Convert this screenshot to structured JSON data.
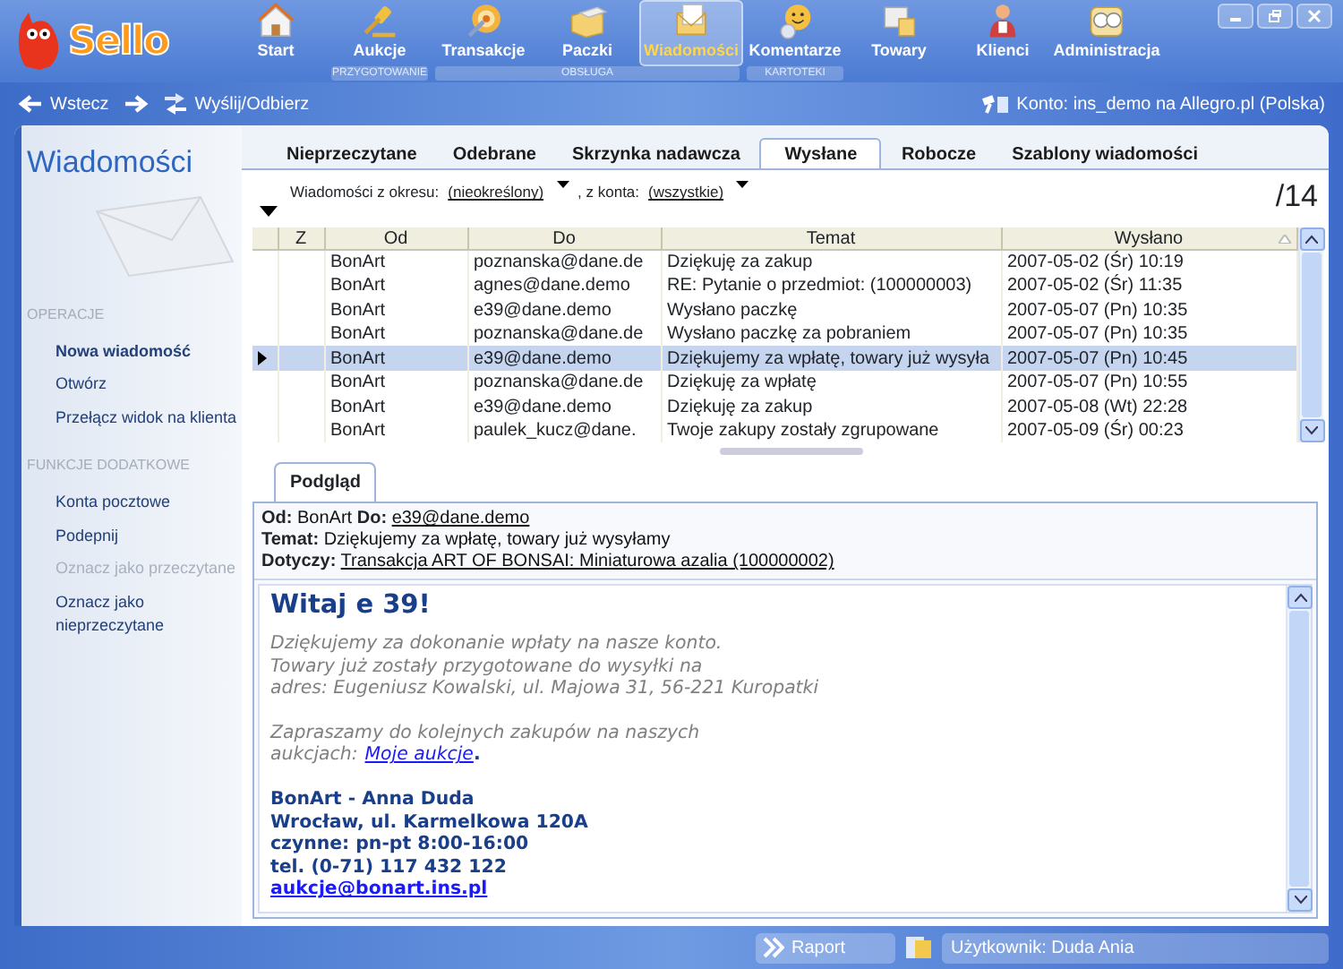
{
  "logo": {
    "text": "Sello"
  },
  "toolbar": [
    {
      "items": [
        {
          "label": "Start",
          "selected": false
        }
      ]
    },
    {
      "group": "PRZYGOTOWANIE",
      "items": [
        {
          "label": "Aukcje",
          "selected": false
        }
      ]
    },
    {
      "group": "OBSŁUGA",
      "items": [
        {
          "label": "Transakcje",
          "selected": false
        },
        {
          "label": "Paczki",
          "selected": false
        },
        {
          "label": "Wiadomości",
          "selected": true
        }
      ]
    },
    {
      "group": "KARTOTEKI",
      "items": [
        {
          "label": "Komentarze",
          "selected": false
        }
      ]
    },
    {
      "items": [
        {
          "label": "Towary",
          "selected": false
        },
        {
          "label": "Klienci",
          "selected": false
        },
        {
          "label": "Administracja",
          "selected": false
        }
      ]
    }
  ],
  "nav": {
    "back": "Wstecz",
    "send_receive": "Wyślij/Odbierz",
    "account": "Konto: ins_demo na Allegro.pl (Polska)"
  },
  "sidebar": {
    "title": "Wiadomości",
    "sections": [
      {
        "heading": "OPERACJE",
        "items": [
          {
            "label": "Nowa wiadomość",
            "default": true,
            "disabled": false
          },
          {
            "label": "Otwórz",
            "default": false,
            "disabled": false
          },
          {
            "label": "Przełącz widok na klienta",
            "default": false,
            "disabled": false
          }
        ]
      },
      {
        "heading": "FUNKCJE DODATKOWE",
        "items": [
          {
            "label": "Konta pocztowe",
            "default": false,
            "disabled": false
          },
          {
            "label": "Podepnij",
            "default": false,
            "disabled": false
          },
          {
            "label": "Oznacz jako przeczytane",
            "default": false,
            "disabled": true
          },
          {
            "label": "Oznacz jako nieprzeczytane",
            "default": false,
            "disabled": false
          }
        ]
      }
    ]
  },
  "tabs": [
    {
      "label": "Nieprzeczytane",
      "selected": false
    },
    {
      "label": "Odebrane",
      "selected": false
    },
    {
      "label": "Skrzynka nadawcza",
      "selected": false
    },
    {
      "label": "Wysłane",
      "selected": true
    },
    {
      "label": "Robocze",
      "selected": false
    },
    {
      "label": "Szablony wiadomości",
      "selected": false
    }
  ],
  "filter": {
    "period_label": "Wiadomości z okresu:",
    "period": "(nieokreślony)",
    "account_label": ", z konta:",
    "account": "(wszystkie)",
    "count": "/14"
  },
  "table": {
    "columns": [
      {
        "label": "Z",
        "sorted": false
      },
      {
        "label": "Od",
        "sorted": false
      },
      {
        "label": "Do",
        "sorted": false
      },
      {
        "label": "Temat",
        "sorted": false
      },
      {
        "label": "Wysłano",
        "sorted": true
      }
    ],
    "rows": [
      {
        "from": "BonArt",
        "to": "poznanska@dane.de",
        "subject": "Dziękuję za zakup",
        "sent": "2007-05-02 (Śr) 10:19",
        "selected": false
      },
      {
        "from": "BonArt",
        "to": "agnes@dane.demo",
        "subject": "RE: Pytanie o przedmiot: (100000003)",
        "sent": "2007-05-02 (Śr) 11:35",
        "selected": false
      },
      {
        "from": "BonArt",
        "to": "e39@dane.demo",
        "subject": "Wysłano paczkę",
        "sent": "2007-05-07 (Pn) 10:35",
        "selected": false
      },
      {
        "from": "BonArt",
        "to": "poznanska@dane.de",
        "subject": "Wysłano paczkę za pobraniem",
        "sent": "2007-05-07 (Pn) 10:35",
        "selected": false
      },
      {
        "from": "BonArt",
        "to": "e39@dane.demo",
        "subject": "Dziękujemy za wpłatę, towary już wysyła",
        "sent": "2007-05-07 (Pn) 10:45",
        "selected": true
      },
      {
        "from": "BonArt",
        "to": "poznanska@dane.de",
        "subject": "Dziękuję za wpłatę",
        "sent": "2007-05-07 (Pn) 10:55",
        "selected": false
      },
      {
        "from": "BonArt",
        "to": "e39@dane.demo",
        "subject": "Dziękuję za zakup",
        "sent": "2007-05-08 (Wt) 22:28",
        "selected": false
      },
      {
        "from": "BonArt",
        "to": "paulek_kucz@dane.",
        "subject": "Twoje zakupy zostały zgrupowane",
        "sent": "2007-05-09 (Śr) 00:23",
        "selected": false
      }
    ]
  },
  "preview": {
    "tab": "Podgląd",
    "from_label": "Od:",
    "from": "BonArt",
    "to_label": "Do:",
    "to": "e39@dane.demo",
    "subject_label": "Temat:",
    "subject": "Dziękujemy za wpłatę, towary już wysyłamy",
    "regarding_label": "Dotyczy:",
    "regarding": "Transakcja ART OF BONSAI: Miniaturowa azalia (100000002)"
  },
  "message": {
    "heading": "Witaj e 39!",
    "paragraph_1": [
      "Dziękujemy za dokonanie wpłaty na nasze konto.",
      "Towary już zostały przygotowane do wysyłki na",
      "adres: Eugeniusz Kowalski, ul. Majowa 31, 56-221 Kuropatki"
    ],
    "paragraph_2": {
      "lines": [
        "Zapraszamy do kolejnych zakupów na naszych",
        "aukcjach:"
      ],
      "link": "Moje aukcje",
      "after": "."
    },
    "signature": [
      "BonArt - Anna Duda",
      "Wrocław, ul. Karmelkowa 120A",
      "czynne: pn-pt 8:00-16:00",
      "tel. (0-71) 117 432 122"
    ],
    "email": "aukcje@bonart.ins.pl"
  },
  "status_bar": {
    "report": "Raport",
    "user": "Użytkownik: Duda Ania"
  }
}
